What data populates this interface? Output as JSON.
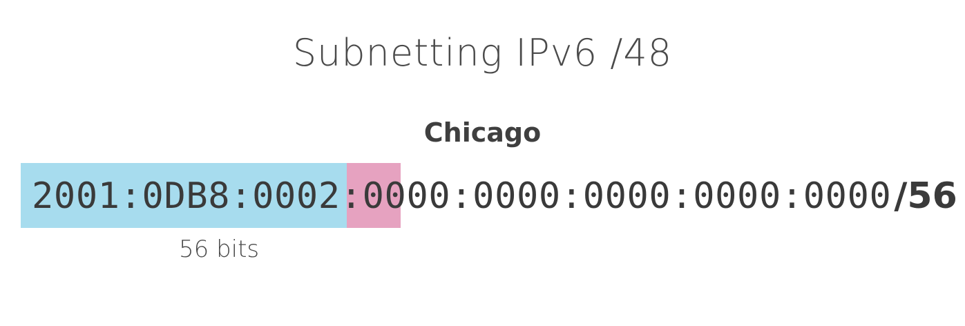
{
  "slide": {
    "title": "Subnetting IPv6 /48",
    "location": "Chicago",
    "address": {
      "network_part": "2001:0DB8:0002:",
      "subnet_part": "00",
      "interface_part": "00:0000:0000:0000:0000",
      "prefix_length": "/56"
    },
    "bits_label": "56 bits",
    "colors": {
      "network_highlight": "#a7dcee",
      "subnet_highlight": "#e6a2c0",
      "text": "#3f3f3f"
    }
  }
}
